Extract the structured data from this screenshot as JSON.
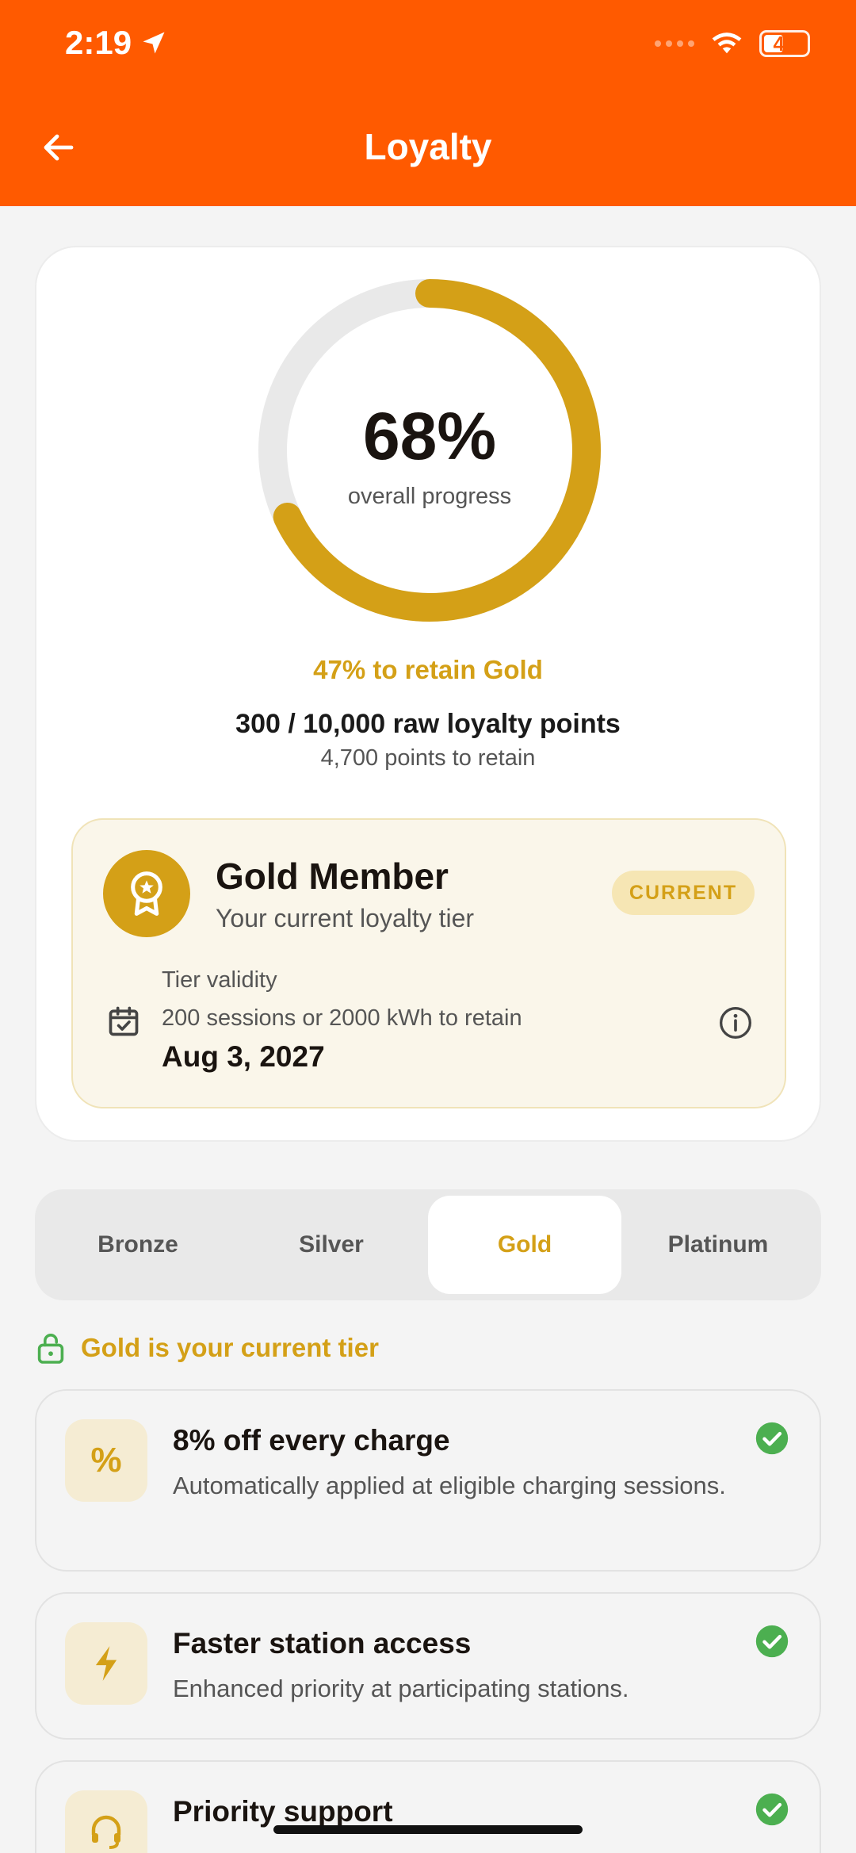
{
  "status_bar": {
    "time": "2:19",
    "battery": "47"
  },
  "header": {
    "title": "Loyalty"
  },
  "progress": {
    "percent_label": "68%",
    "percent_value": 0.68,
    "subtitle": "overall progress",
    "retain_text": "47% to retain Gold",
    "points_text": "300 / 10,000 raw loyalty points",
    "points_remaining": "4,700 points to retain"
  },
  "tier": {
    "name": "Gold Member",
    "description": "Your current loyalty tier",
    "badge": "CURRENT",
    "validity_label": "Tier validity",
    "validity_rule": "200 sessions or 2000 kWh to retain",
    "validity_date": "Aug 3, 2027"
  },
  "tabs": [
    {
      "label": "Bronze"
    },
    {
      "label": "Silver"
    },
    {
      "label": "Gold"
    },
    {
      "label": "Platinum"
    }
  ],
  "current_tier_note": "Gold is your current tier",
  "benefits": [
    {
      "title": "8% off every charge",
      "description": "Automatically applied at eligible charging sessions.",
      "icon": "percent-icon",
      "icon_glyph": "%"
    },
    {
      "title": "Faster station access",
      "description": "Enhanced priority at participating stations.",
      "icon": "lightning-icon",
      "icon_glyph": "⚡"
    },
    {
      "title": "Priority support",
      "description": "",
      "icon": "headset-icon",
      "icon_glyph": ""
    }
  ],
  "colors": {
    "header": "#ff5a00",
    "gold": "#d4a017",
    "ring_track": "#e9e9e9",
    "check_green": "#4caf50"
  }
}
